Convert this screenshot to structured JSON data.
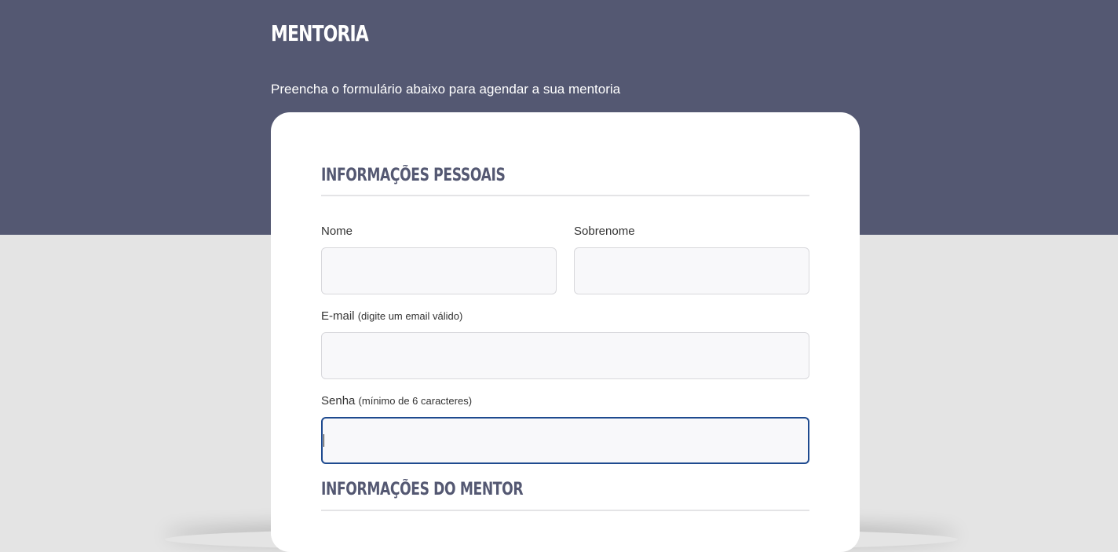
{
  "header": {
    "brand": "MENTORIA",
    "subtitle": "Preencha o formulário abaixo para agendar a sua mentoria"
  },
  "form": {
    "personal_section_title": "INFORMAÇÕES PESSOAIS",
    "first_name": {
      "label": "Nome",
      "value": ""
    },
    "last_name": {
      "label": "Sobrenome",
      "value": ""
    },
    "email": {
      "label": "E-mail",
      "hint": "(digite um email válido)",
      "value": ""
    },
    "password": {
      "label": "Senha",
      "hint": "(mínimo de 6 caracteres)",
      "value": ""
    },
    "mentor_section_title": "INFORMAÇÕES DO MENTOR"
  },
  "colors": {
    "header_bg": "#545872",
    "page_bg": "#e4e4e4",
    "focus_border": "#1e4a8f"
  }
}
